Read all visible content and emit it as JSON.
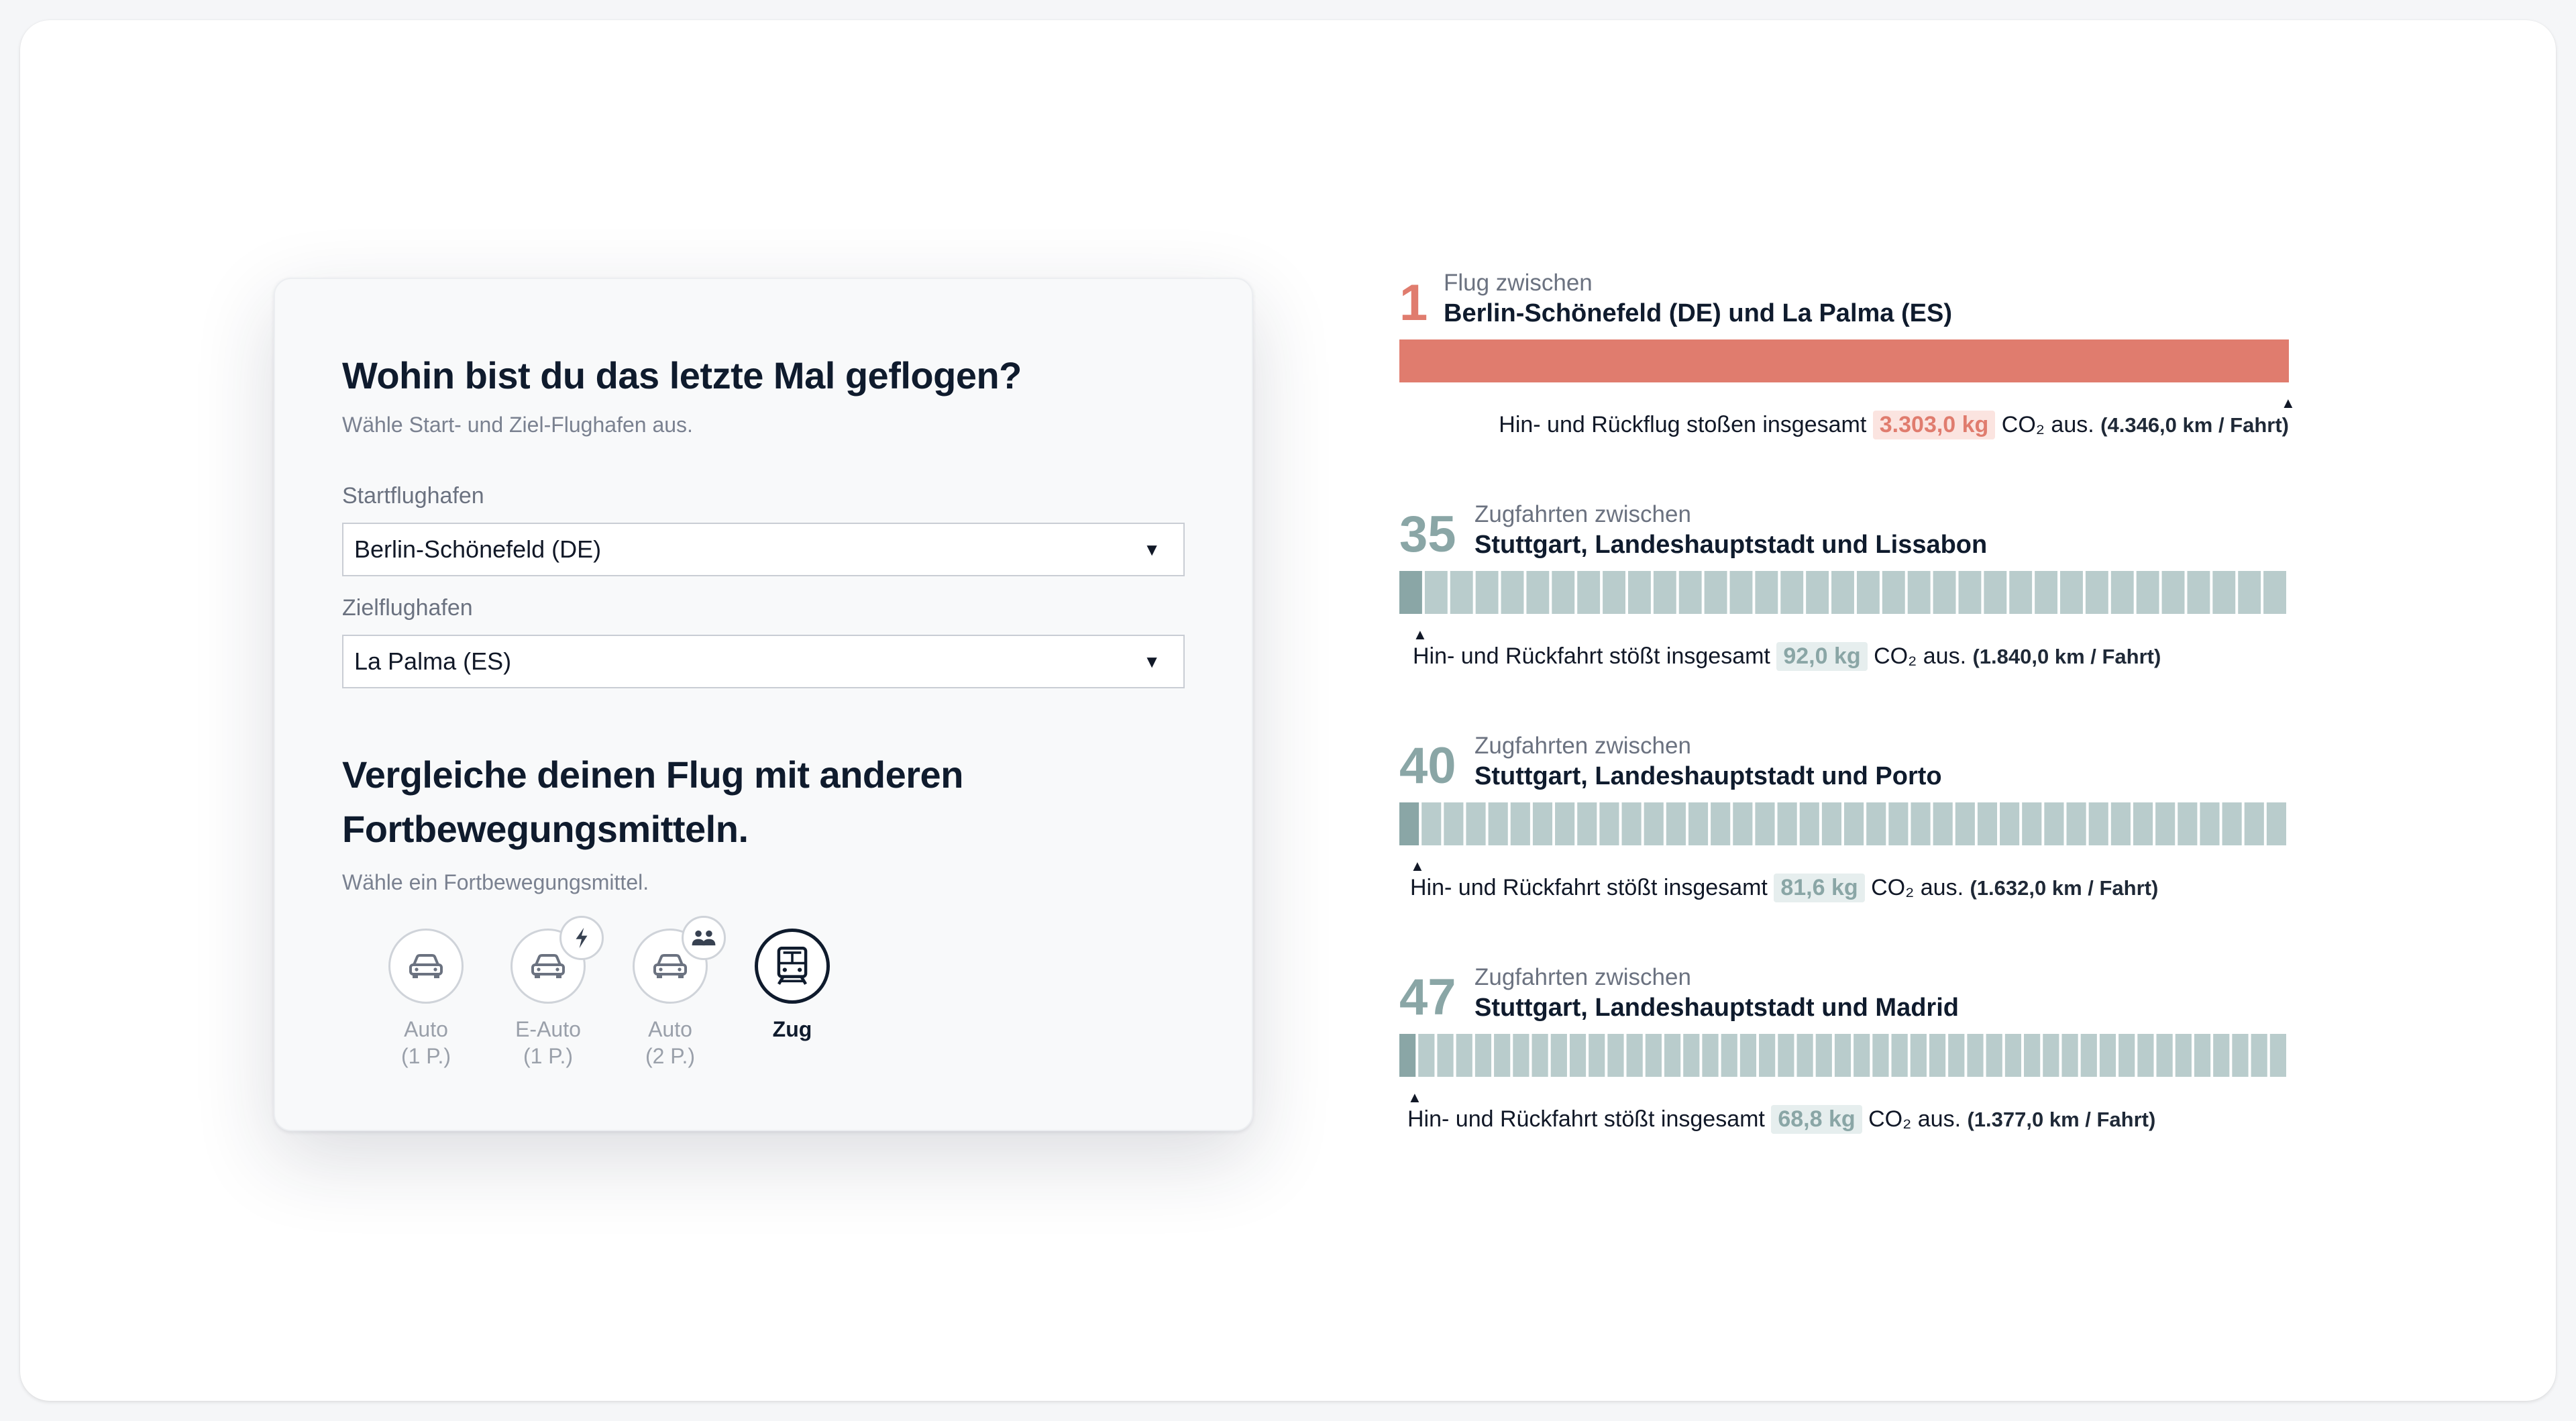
{
  "form": {
    "title": "Wohin bist du das letzte Mal geflogen?",
    "subtitle": "Wähle Start- und Ziel-Flughafen aus.",
    "origin_label": "Startflughafen",
    "origin_value": "Berlin-Schönefeld (DE)",
    "destination_label": "Zielflughafen",
    "destination_value": "La Palma (ES)",
    "dropdown_arrow": "▼",
    "compare_title": "Vergleiche deinen Flug mit anderen Fortbewegungsmitteln.",
    "compare_subtitle": "Wähle ein Fortbewegungsmittel.",
    "modes": [
      {
        "label_1": "Auto",
        "label_2": "(1 P.)",
        "icon": "car-icon",
        "active": false
      },
      {
        "label_1": "E-Auto",
        "label_2": "(1 P.)",
        "icon": "car-icon",
        "badge": "lightning-icon",
        "active": false
      },
      {
        "label_1": "Auto",
        "label_2": "(2 P.)",
        "icon": "car-icon",
        "badge": "people-icon",
        "active": false
      },
      {
        "label_1": "Zug",
        "label_2": "",
        "icon": "train-icon",
        "active": true
      }
    ]
  },
  "results": [
    {
      "count": "1",
      "title_1": "Flug zwischen",
      "title_2": "Berlin-Schönefeld (DE) und La Palma (ES)",
      "desc_pre": "Hin- und Rückflug stoßen insgesamt",
      "value": "3.303,0 kg",
      "desc_co2": "CO₂ aus.",
      "distance": "(4.346,0 km / Fahrt)",
      "kind": "flight",
      "segments": 1
    },
    {
      "count": "35",
      "title_1": "Zugfahrten zwischen",
      "title_2": "Stuttgart, Landeshauptstadt und Lissabon",
      "desc_pre": "Hin- und Rückfahrt stößt insgesamt",
      "value": "92,0 kg",
      "desc_co2": "CO₂ aus.",
      "distance": "(1.840,0 km / Fahrt)",
      "kind": "train",
      "segments": 35
    },
    {
      "count": "40",
      "title_1": "Zugfahrten zwischen",
      "title_2": "Stuttgart, Landeshauptstadt und Porto",
      "desc_pre": "Hin- und Rückfahrt stößt insgesamt",
      "value": "81,6 kg",
      "desc_co2": "CO₂ aus.",
      "distance": "(1.632,0 km / Fahrt)",
      "kind": "train",
      "segments": 40
    },
    {
      "count": "47",
      "title_1": "Zugfahrten zwischen",
      "title_2": "Stuttgart, Landeshauptstadt und Madrid",
      "desc_pre": "Hin- und Rückfahrt stößt insgesamt",
      "value": "68,8 kg",
      "desc_co2": "CO₂ aus.",
      "distance": "(1.377,0 km / Fahrt)",
      "kind": "train",
      "segments": 47
    }
  ],
  "colors": {
    "flight": "#e07c6e",
    "train_segment": "#b9cccc",
    "train_first": "#8aa6a6",
    "segment_gap": "#ffffff"
  }
}
